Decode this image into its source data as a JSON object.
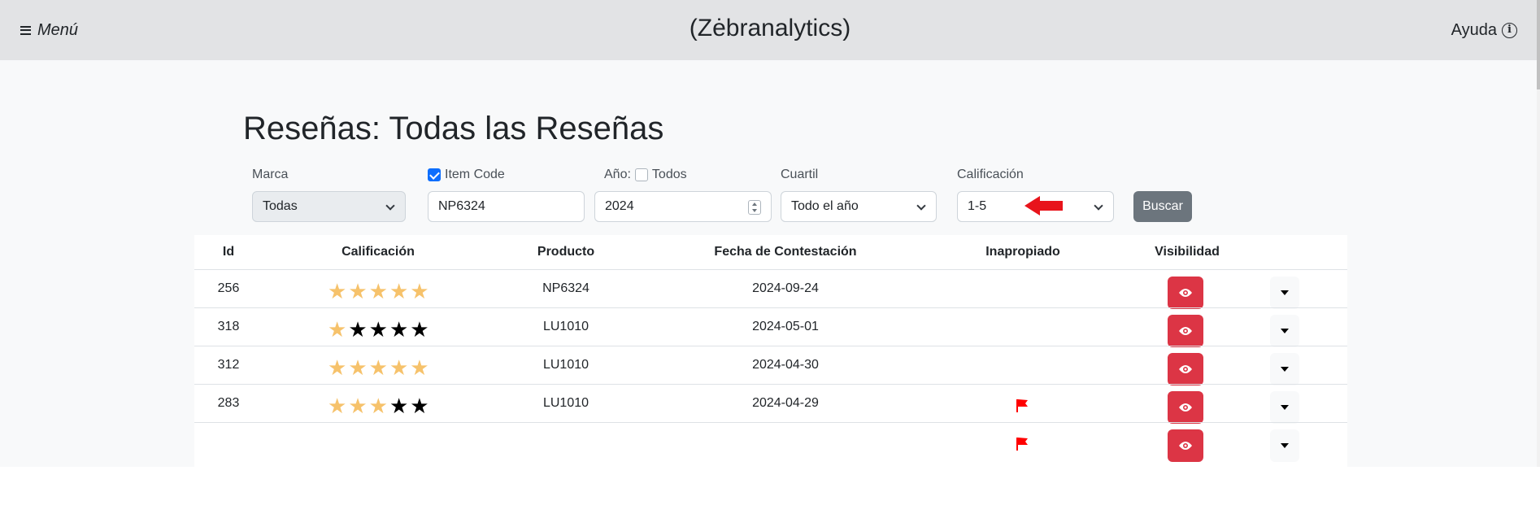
{
  "navbar": {
    "menu_label": "Menú",
    "brand": "(Zėbranalytics)",
    "help_label": "Ayuda"
  },
  "page": {
    "title": "Reseñas: Todas las Reseñas"
  },
  "filters": {
    "marca": {
      "label": "Marca",
      "value": "Todas"
    },
    "item_code": {
      "label": "Item Code",
      "checked": true,
      "value": "NP6324"
    },
    "anio": {
      "label": "Año:",
      "todos_label": "Todos",
      "todos_checked": false,
      "value": "2024"
    },
    "cuartil": {
      "label": "Cuartil",
      "value": "Todo el año"
    },
    "calificacion": {
      "label": "Calificación",
      "value": "1-5"
    },
    "search_button": "Buscar"
  },
  "table": {
    "headers": {
      "id": "Id",
      "calificacion": "Calificación",
      "producto": "Producto",
      "fecha": "Fecha de Contestación",
      "inapropiado": "Inapropiado",
      "visibilidad": "Visibilidad"
    },
    "rows": [
      {
        "id": "256",
        "rating": 5,
        "product": "NP6324",
        "date": "2024-09-24",
        "flagged": false
      },
      {
        "id": "318",
        "rating": 1,
        "product": "LU1010",
        "date": "2024-05-01",
        "flagged": false
      },
      {
        "id": "312",
        "rating": 5,
        "product": "LU1010",
        "date": "2024-04-30",
        "flagged": false
      },
      {
        "id": "283",
        "rating": 3,
        "product": "LU1010",
        "date": "2024-04-29",
        "flagged": true
      },
      {
        "id": "",
        "rating": 0,
        "product": "",
        "date": "",
        "flagged": true
      }
    ],
    "max_rating": 5
  },
  "colors": {
    "navbar_bg": "#e2e3e5",
    "star_filled": "#f6c26b",
    "star_empty": "#000000",
    "danger": "#dc3545",
    "secondary": "#6c757d",
    "flag": "#ff0000",
    "annotation_arrow": "#e8141b"
  },
  "icons": {
    "menu": "hamburger-icon",
    "help": "info-circle-icon",
    "visibility": "eye-icon",
    "flag": "flag-icon",
    "dropdown": "caret-down-icon",
    "select": "chevron-down-icon",
    "annotation": "red-arrow-icon"
  }
}
